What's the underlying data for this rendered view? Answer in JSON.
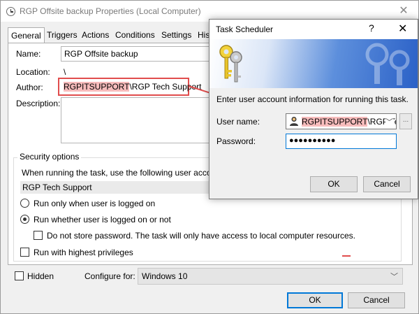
{
  "props_window": {
    "title": "RGP Offsite backup Properties (Local Computer)",
    "close": "✕",
    "tabs": [
      "General",
      "Triggers",
      "Actions",
      "Conditions",
      "Settings",
      "Hist"
    ],
    "name_label": "Name:",
    "name_value": "RGP Offsite backup",
    "location_label": "Location:",
    "location_value": "\\",
    "author_label": "Author:",
    "author_domain": "RGPITSUPPORT",
    "author_rest": "\\RGP Tech Support",
    "description_label": "Description:",
    "security_title": "Security options",
    "security_text": "When running the task, use the following user account",
    "security_account": "RGP Tech Support",
    "radio_logged_on": "Run only when user is logged on",
    "radio_whether": "Run whether user is logged on or not",
    "do_not_store": "Do not store password.  The task will only have access to local computer resources.",
    "highest_priv": "Run with highest privileges",
    "hidden_label": "Hidden",
    "configure_label": "Configure for:",
    "configure_value": "Windows 10",
    "ok": "OK",
    "cancel": "Cancel"
  },
  "dialog": {
    "title": "Task Scheduler",
    "help": "?",
    "close": "✕",
    "message": "Enter user account information for running this task.",
    "user_label": "User name:",
    "user_domain": "RGPITSUPPORT",
    "user_rest": "\\RGP Tech",
    "browse": "...",
    "password_label": "Password:",
    "password_value": "●●●●●●●●●●",
    "ok": "OK",
    "cancel": "Cancel"
  },
  "icons": {
    "dropdown": "﹀",
    "arrow_color": "#e14d4d"
  }
}
